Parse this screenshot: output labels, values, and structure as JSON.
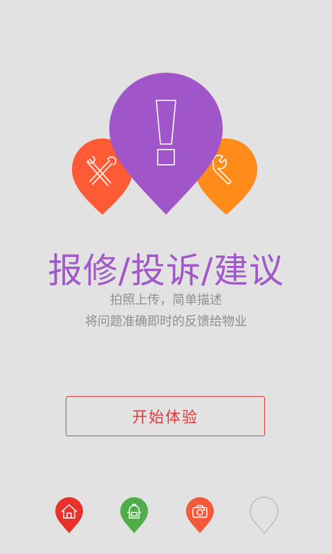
{
  "hero": {
    "title": "报修/投诉/建议",
    "subtitle_line1": "拍照上传，简单描述",
    "subtitle_line2": "将问题准确即时的反馈给物业"
  },
  "cta": {
    "label": "开始体验"
  },
  "illustration": {
    "pins": [
      {
        "name": "repair-pin",
        "color": "#ff5a36",
        "icon": "screwdriver-wrench-icon"
      },
      {
        "name": "complaint-pin",
        "color": "#a055c8",
        "icon": "exclamation-icon"
      },
      {
        "name": "suggestion-pin",
        "color": "#ff8b1a",
        "icon": "wrench-icon"
      }
    ]
  },
  "pager": {
    "pages": [
      {
        "icon": "home-icon",
        "color": "#e8302c",
        "active": true
      },
      {
        "icon": "backpack-icon",
        "color": "#4fae49",
        "active": true
      },
      {
        "icon": "camera-icon",
        "color": "#f25a3a",
        "active": true
      },
      {
        "icon": "empty-pin-icon",
        "color": "#bdbdbd",
        "active": false
      }
    ]
  },
  "colors": {
    "background": "#e2e2e2",
    "title": "#a159c9",
    "subtitle": "#8e8e8e",
    "cta": "#e33a3a"
  }
}
